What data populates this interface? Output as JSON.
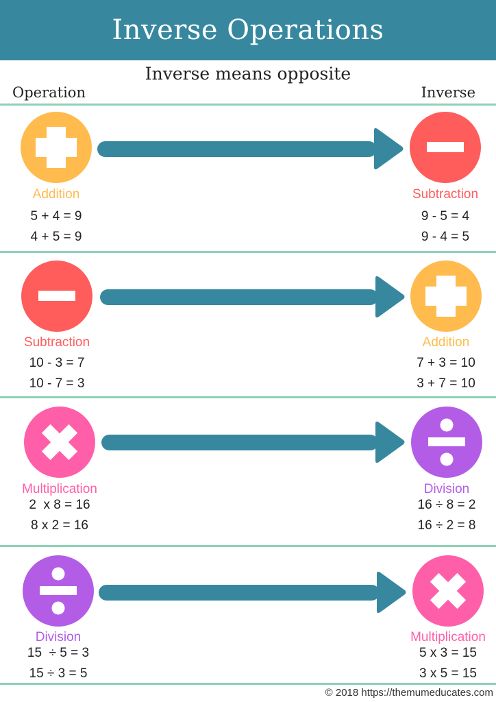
{
  "header": {
    "title": "Inverse Operations"
  },
  "subtitle": "Inverse means opposite",
  "columns": {
    "left": "Operation",
    "right": "Inverse"
  },
  "colors": {
    "header_bg": "#37889f",
    "arrow": "#37889f",
    "divider": "#8ed1b5",
    "addition": "#ffbb4d",
    "subtraction": "#ff5c5c",
    "multiplication": "#ff5fa8",
    "division": "#b35de6"
  },
  "rows": [
    {
      "operation": {
        "name": "Addition",
        "icon": "plus-icon",
        "equations": [
          "5 + 4 = 9",
          "4 + 5 = 9"
        ]
      },
      "inverse": {
        "name": "Subtraction",
        "icon": "minus-icon",
        "equations": [
          "9 - 5 = 4",
          "9 - 4 = 5"
        ]
      }
    },
    {
      "operation": {
        "name": "Subtraction",
        "icon": "minus-icon",
        "equations": [
          "10 - 3 = 7",
          "10 - 7 = 3"
        ]
      },
      "inverse": {
        "name": "Addition",
        "icon": "plus-icon",
        "equations": [
          "7 + 3 = 10",
          "3 + 7 = 10"
        ]
      }
    },
    {
      "operation": {
        "name": "Multiplication",
        "icon": "times-icon",
        "equations": [
          "2  x 8 = 16",
          "8 x 2 = 16"
        ]
      },
      "inverse": {
        "name": "Division",
        "icon": "divide-icon",
        "equations": [
          "16 ÷ 8 = 2",
          "16 ÷ 2 = 8"
        ]
      }
    },
    {
      "operation": {
        "name": "Division",
        "icon": "divide-icon",
        "equations": [
          "15  ÷ 5 = 3",
          "15 ÷ 3 = 5"
        ]
      },
      "inverse": {
        "name": "Multiplication",
        "icon": "times-icon",
        "equations": [
          "5 x 3 = 15",
          "3 x 5 = 15"
        ]
      }
    }
  ],
  "footer": "© 2018   https://themumeducates.com"
}
